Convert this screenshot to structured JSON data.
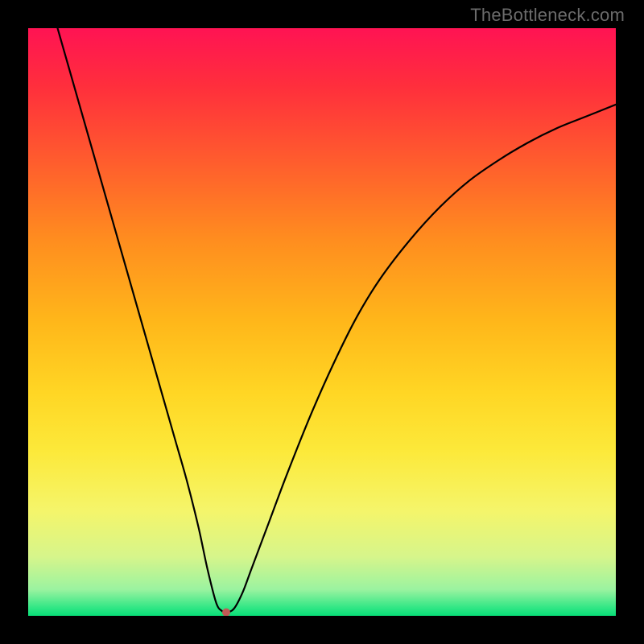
{
  "chart_data": {
    "type": "line",
    "title": "",
    "subtitle": "",
    "xlabel": "",
    "ylabel": "",
    "xlim": [
      0,
      100
    ],
    "ylim": [
      0,
      100
    ],
    "grid": false,
    "legend_position": "none",
    "annotations": [
      "TheBottleneck.com"
    ],
    "background_gradient_stops": [
      {
        "pos": 0.0,
        "color": "#ff1353"
      },
      {
        "pos": 0.1,
        "color": "#ff2f3c"
      },
      {
        "pos": 0.22,
        "color": "#ff5a2e"
      },
      {
        "pos": 0.36,
        "color": "#ff8d1f"
      },
      {
        "pos": 0.5,
        "color": "#ffb71a"
      },
      {
        "pos": 0.62,
        "color": "#ffd624"
      },
      {
        "pos": 0.72,
        "color": "#fce93a"
      },
      {
        "pos": 0.82,
        "color": "#f5f56a"
      },
      {
        "pos": 0.9,
        "color": "#d6f58b"
      },
      {
        "pos": 0.955,
        "color": "#9bf3a0"
      },
      {
        "pos": 0.985,
        "color": "#35e786"
      },
      {
        "pos": 1.0,
        "color": "#08df78"
      }
    ],
    "series": [
      {
        "name": "curve",
        "x": [
          5,
          7,
          9,
          11,
          13,
          15,
          17,
          19,
          21,
          23,
          25,
          27,
          29,
          30.5,
          32,
          33,
          33.7,
          35,
          36.5,
          38,
          41,
          44,
          48,
          52,
          56,
          60,
          65,
          70,
          75,
          80,
          85,
          90,
          95,
          100
        ],
        "y": [
          100,
          93,
          86,
          79,
          72,
          65,
          58,
          51,
          44,
          37,
          30,
          23,
          15,
          8,
          2.2,
          0.8,
          0.6,
          1.2,
          4,
          8,
          16,
          24,
          34,
          43,
          51,
          57.5,
          64,
          69.5,
          74,
          77.5,
          80.5,
          83,
          85,
          87
        ]
      }
    ],
    "marker": {
      "x": 33.7,
      "y": 0.6,
      "color": "#c05a56",
      "radius": 5
    }
  },
  "watermark": "TheBottleneck.com"
}
